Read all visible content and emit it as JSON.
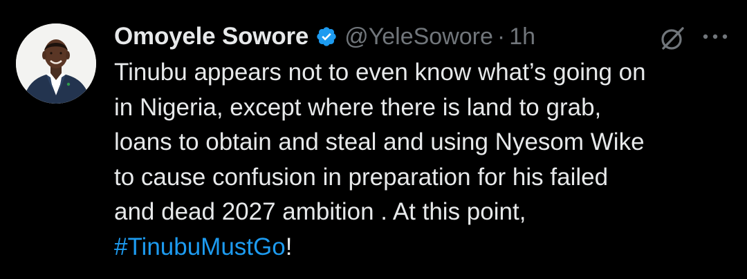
{
  "author": {
    "display_name": "Omoyele Sowore",
    "handle": "@YeleSowore",
    "separator": "·",
    "time": "1h",
    "verified": true
  },
  "tweet": {
    "lines": [
      "Tinubu appears not to even know what’s going on",
      "in Nigeria, except where there is land to grab,",
      "loans to obtain and steal and using Nyesom Wike",
      "to cause confusion in preparation for his failed",
      "and dead 2027 ambition . At this point,"
    ],
    "hashtag": "#TinubuMustGo",
    "final_punctuation": "!"
  },
  "icons": {
    "verified": "verified-badge-icon",
    "grok": "grok-icon",
    "more": "more-options-icon"
  },
  "colors": {
    "background": "#000000",
    "text": "#e7e9ea",
    "secondary": "#71767b",
    "accent": "#1d9bf0"
  }
}
